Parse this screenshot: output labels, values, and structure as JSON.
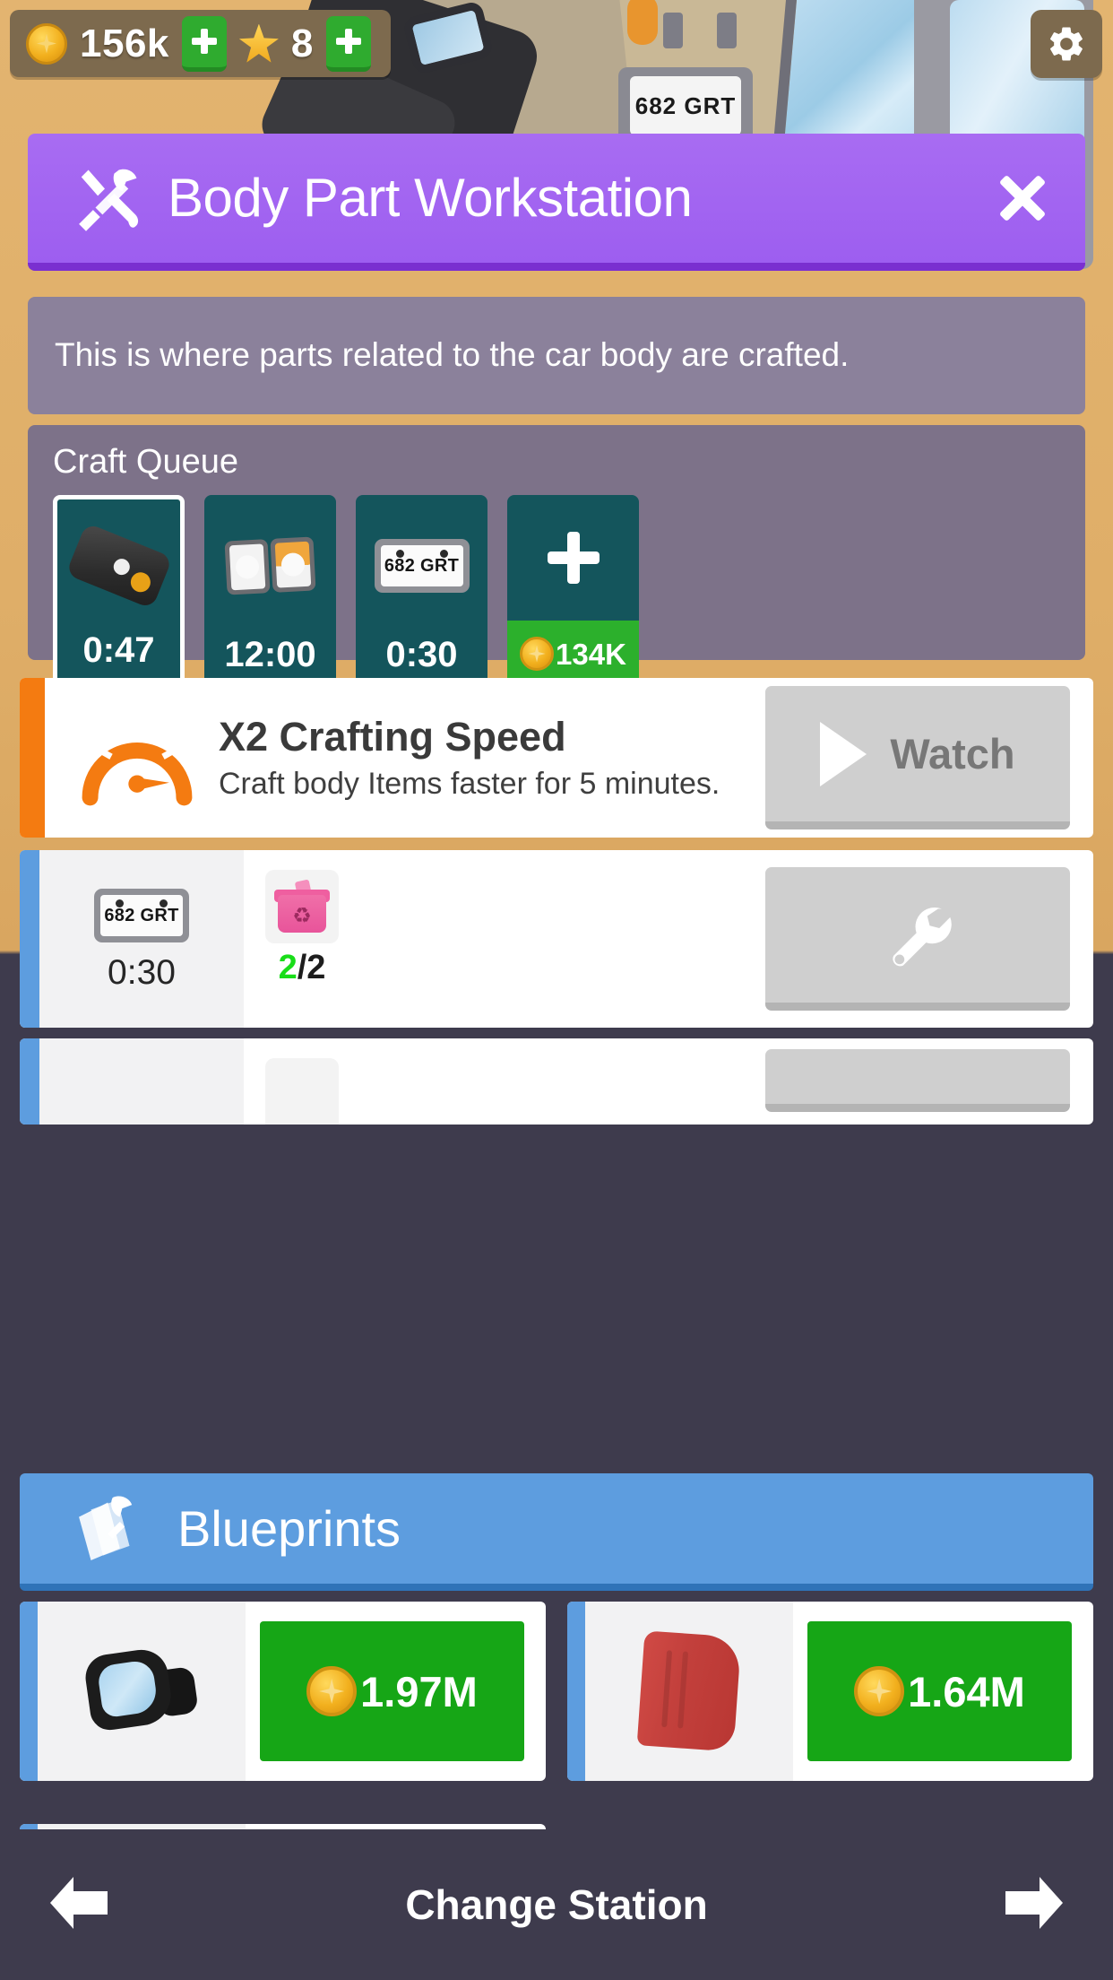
{
  "hud": {
    "coin_icon": "coin-icon",
    "coins": "156k",
    "add_coins_label": "+",
    "star_icon": "star-icon",
    "stars": "8",
    "add_stars_label": "+",
    "settings_icon": "gear-icon",
    "background_plate_text": "682 GRT"
  },
  "panel": {
    "icon": "hammer-wrench-icon",
    "title": "Body Part Workstation",
    "close_icon": "close-icon",
    "accent_color": "#a25cf0",
    "description": "This is where parts related to the car body are crafted."
  },
  "craft_queue": {
    "title": "Craft Queue",
    "slots": [
      {
        "icon": "wiper-blade-icon",
        "time": "0:47",
        "active": true
      },
      {
        "icon": "headlights-icon",
        "time": "12:00",
        "active": false
      },
      {
        "icon": "license-plate-icon",
        "plate_text": "682 GRT",
        "time": "0:30",
        "active": false
      }
    ],
    "add_slot": {
      "plus_label": "+",
      "coin_icon": "coin-icon",
      "price": "134K"
    }
  },
  "boost": {
    "accent_color": "#f47b11",
    "icon": "speedometer-icon",
    "title": "X2 Crafting Speed",
    "subtitle": "Craft body Items faster for 5 minutes.",
    "button": {
      "play_icon": "play-icon",
      "label": "Watch"
    }
  },
  "recipes": [
    {
      "accent_color": "#5d9ddf",
      "item_icon": "license-plate-icon",
      "plate_text": "682 GRT",
      "time": "0:30",
      "materials": [
        {
          "icon": "scrap-bin-icon",
          "have": "2",
          "separator": "/",
          "need": "2"
        }
      ],
      "craft_button_icon": "wrench-icon"
    }
  ],
  "blueprints": {
    "icon": "blueprints-icon",
    "title": "Blueprints",
    "accent_color": "#5d9ddf",
    "items": [
      {
        "icon": "side-mirror-icon",
        "coin_icon": "coin-icon",
        "price": "1.97M"
      },
      {
        "icon": "fender-icon",
        "coin_icon": "coin-icon",
        "price": "1.64M"
      }
    ]
  },
  "bottom_bar": {
    "prev_icon": "arrow-left-icon",
    "label": "Change Station",
    "next_icon": "arrow-right-icon"
  }
}
